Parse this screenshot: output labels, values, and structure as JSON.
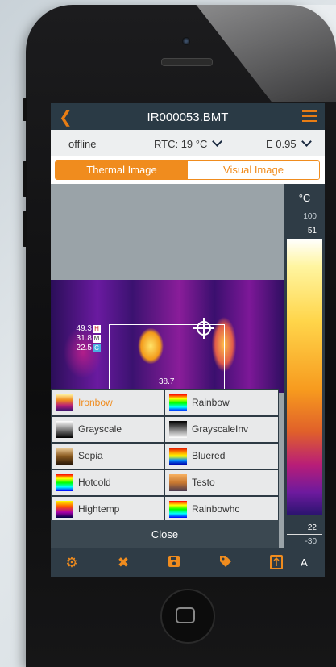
{
  "header": {
    "title": "IR000053.BMT"
  },
  "status": {
    "connection": "offline",
    "rtc": "RTC: 19 °C",
    "emissivity": "E 0.95"
  },
  "tabs": [
    {
      "label": "Thermal Image",
      "active": true
    },
    {
      "label": "Visual Image",
      "active": false
    }
  ],
  "measurements": {
    "high": {
      "value": "49.3",
      "tag": "H"
    },
    "mid": {
      "value": "31.8",
      "tag": "M"
    },
    "low": {
      "value": "22.5",
      "tag": "C"
    },
    "hotspot": "38.7"
  },
  "palettes": [
    {
      "label": "Ironbow",
      "selected": true
    },
    {
      "label": "Rainbow",
      "selected": false
    },
    {
      "label": "Grayscale",
      "selected": false
    },
    {
      "label": "GrayscaleInv",
      "selected": false
    },
    {
      "label": "Sepia",
      "selected": false
    },
    {
      "label": "Bluered",
      "selected": false
    },
    {
      "label": "Hotcold",
      "selected": false
    },
    {
      "label": "Testo",
      "selected": false
    },
    {
      "label": "Hightemp",
      "selected": false
    },
    {
      "label": "Rainbowhc",
      "selected": false
    }
  ],
  "close_label": "Close",
  "scale": {
    "unit": "°C",
    "max_range": "100",
    "max": "51",
    "min": "22",
    "min_range": "-30"
  },
  "toolbar": {
    "mode_label": "A",
    "icons": [
      "settings-icon",
      "tools-icon",
      "save-icon",
      "tag-icon",
      "crop-icon"
    ]
  },
  "colors": {
    "accent": "#f08c1e",
    "header_bg": "#2a3a45",
    "selected_text": "#f08c1e"
  }
}
